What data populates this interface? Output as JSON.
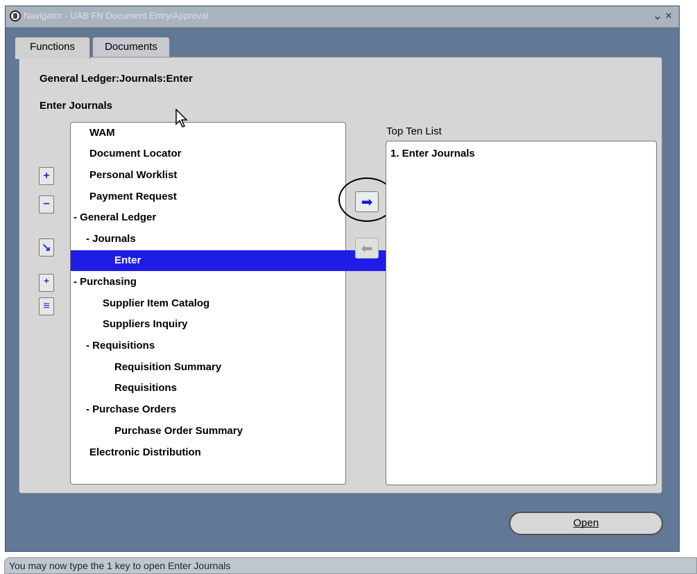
{
  "window": {
    "title": "Navigator - UAB FN Document Entry/Approval",
    "controls": "⊻×"
  },
  "tabs": [
    {
      "label": "Functions",
      "active": true
    },
    {
      "label": "Documents",
      "active": false
    }
  ],
  "breadcrumb": "General Ledger:Journals:Enter",
  "selected_function": "Enter Journals",
  "tree_items": [
    {
      "label": "WAM",
      "prefix": "",
      "indent": 0,
      "selected": false
    },
    {
      "label": "Document Locator",
      "prefix": "",
      "indent": 0,
      "selected": false
    },
    {
      "label": "Personal Worklist",
      "prefix": "",
      "indent": 0,
      "selected": false
    },
    {
      "label": "Payment Request",
      "prefix": "",
      "indent": 0,
      "selected": false
    },
    {
      "label": "General Ledger",
      "prefix": "- ",
      "indent": 0,
      "selected": false
    },
    {
      "label": "Journals",
      "prefix": "- ",
      "indent": 1,
      "selected": false
    },
    {
      "label": "Enter",
      "prefix": "",
      "indent": 2,
      "selected": true
    },
    {
      "label": "Purchasing",
      "prefix": "- ",
      "indent": 0,
      "selected": false
    },
    {
      "label": "Supplier Item Catalog",
      "prefix": "",
      "indent": 1,
      "selected": false
    },
    {
      "label": "Suppliers Inquiry",
      "prefix": "",
      "indent": 1,
      "selected": false
    },
    {
      "label": "Requisitions",
      "prefix": "- ",
      "indent": 1,
      "selected": false
    },
    {
      "label": "Requisition Summary",
      "prefix": "",
      "indent": 2,
      "selected": false
    },
    {
      "label": "Requisitions",
      "prefix": "",
      "indent": 2,
      "selected": false
    },
    {
      "label": "Purchase Orders",
      "prefix": "- ",
      "indent": 1,
      "selected": false
    },
    {
      "label": "Purchase Order Summary",
      "prefix": "",
      "indent": 2,
      "selected": false
    },
    {
      "label": "Electronic Distribution",
      "prefix": "",
      "indent": 0,
      "selected": false
    }
  ],
  "top_ten": {
    "label": "Top Ten List",
    "items": [
      "1. Enter Journals"
    ]
  },
  "buttons": {
    "open": "Open"
  },
  "status": "You may now type the 1 key to open Enter Journals",
  "colors": {
    "window_bg": "#617996",
    "selection": "#1f1ce7"
  }
}
